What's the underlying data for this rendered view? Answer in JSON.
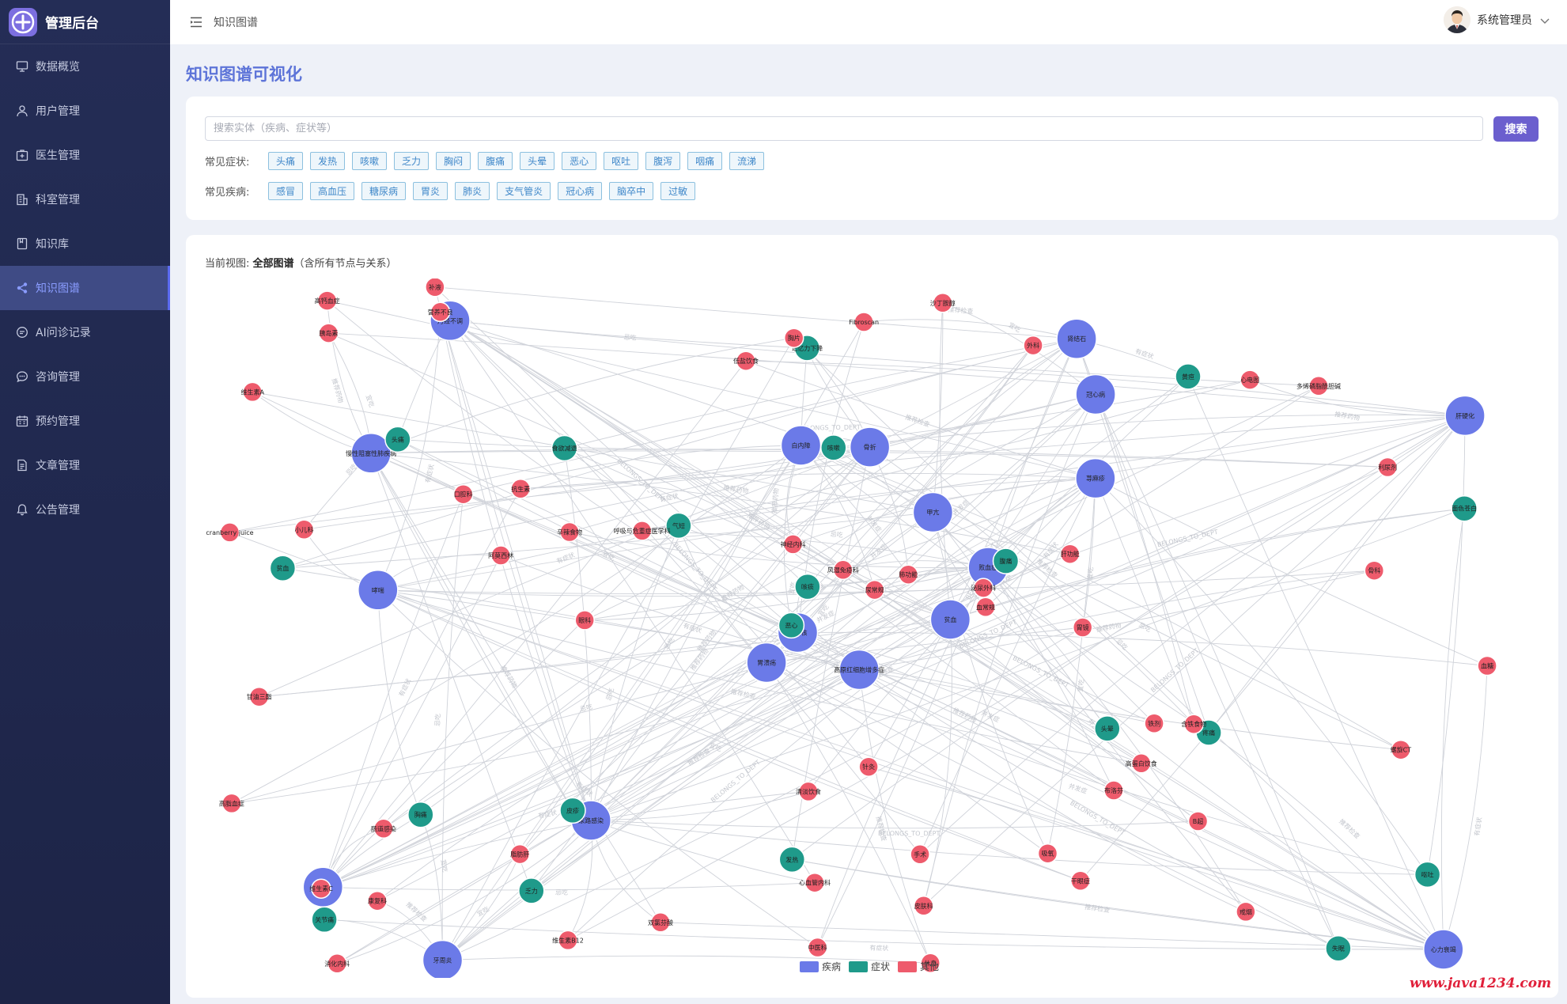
{
  "app": {
    "title": "管理后台"
  },
  "sidebar": {
    "items": [
      {
        "label": "数据概览",
        "icon": "monitor-icon"
      },
      {
        "label": "用户管理",
        "icon": "user-icon"
      },
      {
        "label": "医生管理",
        "icon": "medical-box-icon"
      },
      {
        "label": "科室管理",
        "icon": "building-icon"
      },
      {
        "label": "知识库",
        "icon": "book-icon"
      },
      {
        "label": "知识图谱",
        "icon": "share-icon",
        "active": true
      },
      {
        "label": "AI问诊记录",
        "icon": "chat-icon"
      },
      {
        "label": "咨询管理",
        "icon": "chat-bubble-icon"
      },
      {
        "label": "预约管理",
        "icon": "calendar-icon"
      },
      {
        "label": "文章管理",
        "icon": "document-icon"
      },
      {
        "label": "公告管理",
        "icon": "bell-icon"
      }
    ]
  },
  "header": {
    "breadcrumb": "知识图谱",
    "user_name": "系统管理员"
  },
  "page": {
    "title": "知识图谱可视化"
  },
  "search": {
    "placeholder": "搜索实体（疾病、症状等）",
    "button_label": "搜索",
    "symptoms_label": "常见症状:",
    "symptoms": [
      "头痛",
      "发热",
      "咳嗽",
      "乏力",
      "胸闷",
      "腹痛",
      "头晕",
      "恶心",
      "呕吐",
      "腹泻",
      "咽痛",
      "流涕"
    ],
    "diseases_label": "常见疾病:",
    "diseases": [
      "感冒",
      "高血压",
      "糖尿病",
      "胃炎",
      "肺炎",
      "支气管炎",
      "冠心病",
      "脑卒中",
      "过敏"
    ]
  },
  "graph": {
    "view_prefix": "当前视图:",
    "view_name": "全部图谱",
    "view_suffix": "（含所有节点与关系）",
    "legend": [
      {
        "label": "疾病",
        "color": "#6b7ae8"
      },
      {
        "label": "症状",
        "color": "#1f9a8a"
      },
      {
        "label": "其他",
        "color": "#ee5b6c"
      }
    ],
    "edge_labels": [
      "有症状",
      "推荐药物",
      "BELONGS_TO_DEPT",
      "并发症",
      "推荐检查",
      "宜吃",
      "忌吃"
    ],
    "disease_nodes": [
      {
        "label": "高原红细胞增多症"
      },
      {
        "label": "慢性阻塞性肺疾病"
      },
      {
        "label": "肺结核"
      },
      {
        "label": "痢疾"
      },
      {
        "label": "败血症"
      },
      {
        "label": "尿路感染"
      },
      {
        "label": "肾结石"
      },
      {
        "label": "骨折"
      },
      {
        "label": "冠心病"
      },
      {
        "label": "贫血"
      },
      {
        "label": "月经不调"
      },
      {
        "label": "心力衰竭"
      },
      {
        "label": "哮喘"
      },
      {
        "label": "肝硬化"
      },
      {
        "label": "胃溃疡"
      },
      {
        "label": "荨麻疹"
      },
      {
        "label": "牙周炎"
      },
      {
        "label": "白内障"
      },
      {
        "label": "甲亢"
      }
    ],
    "symptom_nodes": [
      {
        "label": "胸痛"
      },
      {
        "label": "气短"
      },
      {
        "label": "关节痛"
      },
      {
        "label": "乏力"
      },
      {
        "label": "咳嗽"
      },
      {
        "label": "腹痛"
      },
      {
        "label": "疼痛"
      },
      {
        "label": "头痛"
      },
      {
        "label": "记忆力下降"
      },
      {
        "label": "贫血"
      },
      {
        "label": "头晕"
      },
      {
        "label": "面色苍白"
      },
      {
        "label": "恶心"
      },
      {
        "label": "发热"
      },
      {
        "label": "咳痰"
      },
      {
        "label": "食欲减退"
      },
      {
        "label": "黄疸"
      },
      {
        "label": "皮疹"
      },
      {
        "label": "失眠"
      },
      {
        "label": "呕吐"
      }
    ],
    "other_nodes": [
      {
        "label": "含铁食物"
      },
      {
        "label": "沙丁胺醇"
      },
      {
        "label": "呼吸与危重症医学科"
      },
      {
        "label": "阿莫西林"
      },
      {
        "label": "布洛芬"
      },
      {
        "label": "维生素B12"
      },
      {
        "label": "cranberry juice"
      },
      {
        "label": "泌尿外科"
      },
      {
        "label": "消化内科"
      },
      {
        "label": "心血管内科"
      },
      {
        "label": "血常规"
      },
      {
        "label": "肠道感染"
      },
      {
        "label": "利尿剂"
      },
      {
        "label": "维生素A"
      },
      {
        "label": "高蛋白饮食"
      },
      {
        "label": "干眼症"
      },
      {
        "label": "脂肪肝"
      },
      {
        "label": "营养不良"
      },
      {
        "label": "高钙血症"
      },
      {
        "label": "手术"
      },
      {
        "label": "多烯磷脂酰胆碱"
      },
      {
        "label": "Fibroscan"
      },
      {
        "label": "眼科"
      },
      {
        "label": "小儿科"
      },
      {
        "label": "抗生素"
      },
      {
        "label": "心电图"
      },
      {
        "label": "补液"
      },
      {
        "label": "外科"
      },
      {
        "label": "低盐饮食"
      },
      {
        "label": "风湿免疫科"
      },
      {
        "label": "高脂血症"
      },
      {
        "label": "清淡饮食"
      },
      {
        "label": "双氯芬酸"
      },
      {
        "label": "铁剂"
      },
      {
        "label": "辛辣食物"
      },
      {
        "label": "维生素C"
      },
      {
        "label": "胰岛素"
      },
      {
        "label": "口腔科"
      },
      {
        "label": "甘油三酯"
      },
      {
        "label": "神经内科"
      },
      {
        "label": "皮肤科"
      },
      {
        "label": "肺功能"
      },
      {
        "label": "康复科"
      },
      {
        "label": "胃镜"
      },
      {
        "label": "螺旋CT"
      },
      {
        "label": "中医科"
      },
      {
        "label": "骨科"
      },
      {
        "label": "针灸"
      },
      {
        "label": "戒烟"
      },
      {
        "label": "休息"
      },
      {
        "label": "吸氧"
      },
      {
        "label": "胸片"
      },
      {
        "label": "血糖"
      },
      {
        "label": "肝功能"
      },
      {
        "label": "B超"
      },
      {
        "label": "尿常规"
      }
    ]
  }
}
